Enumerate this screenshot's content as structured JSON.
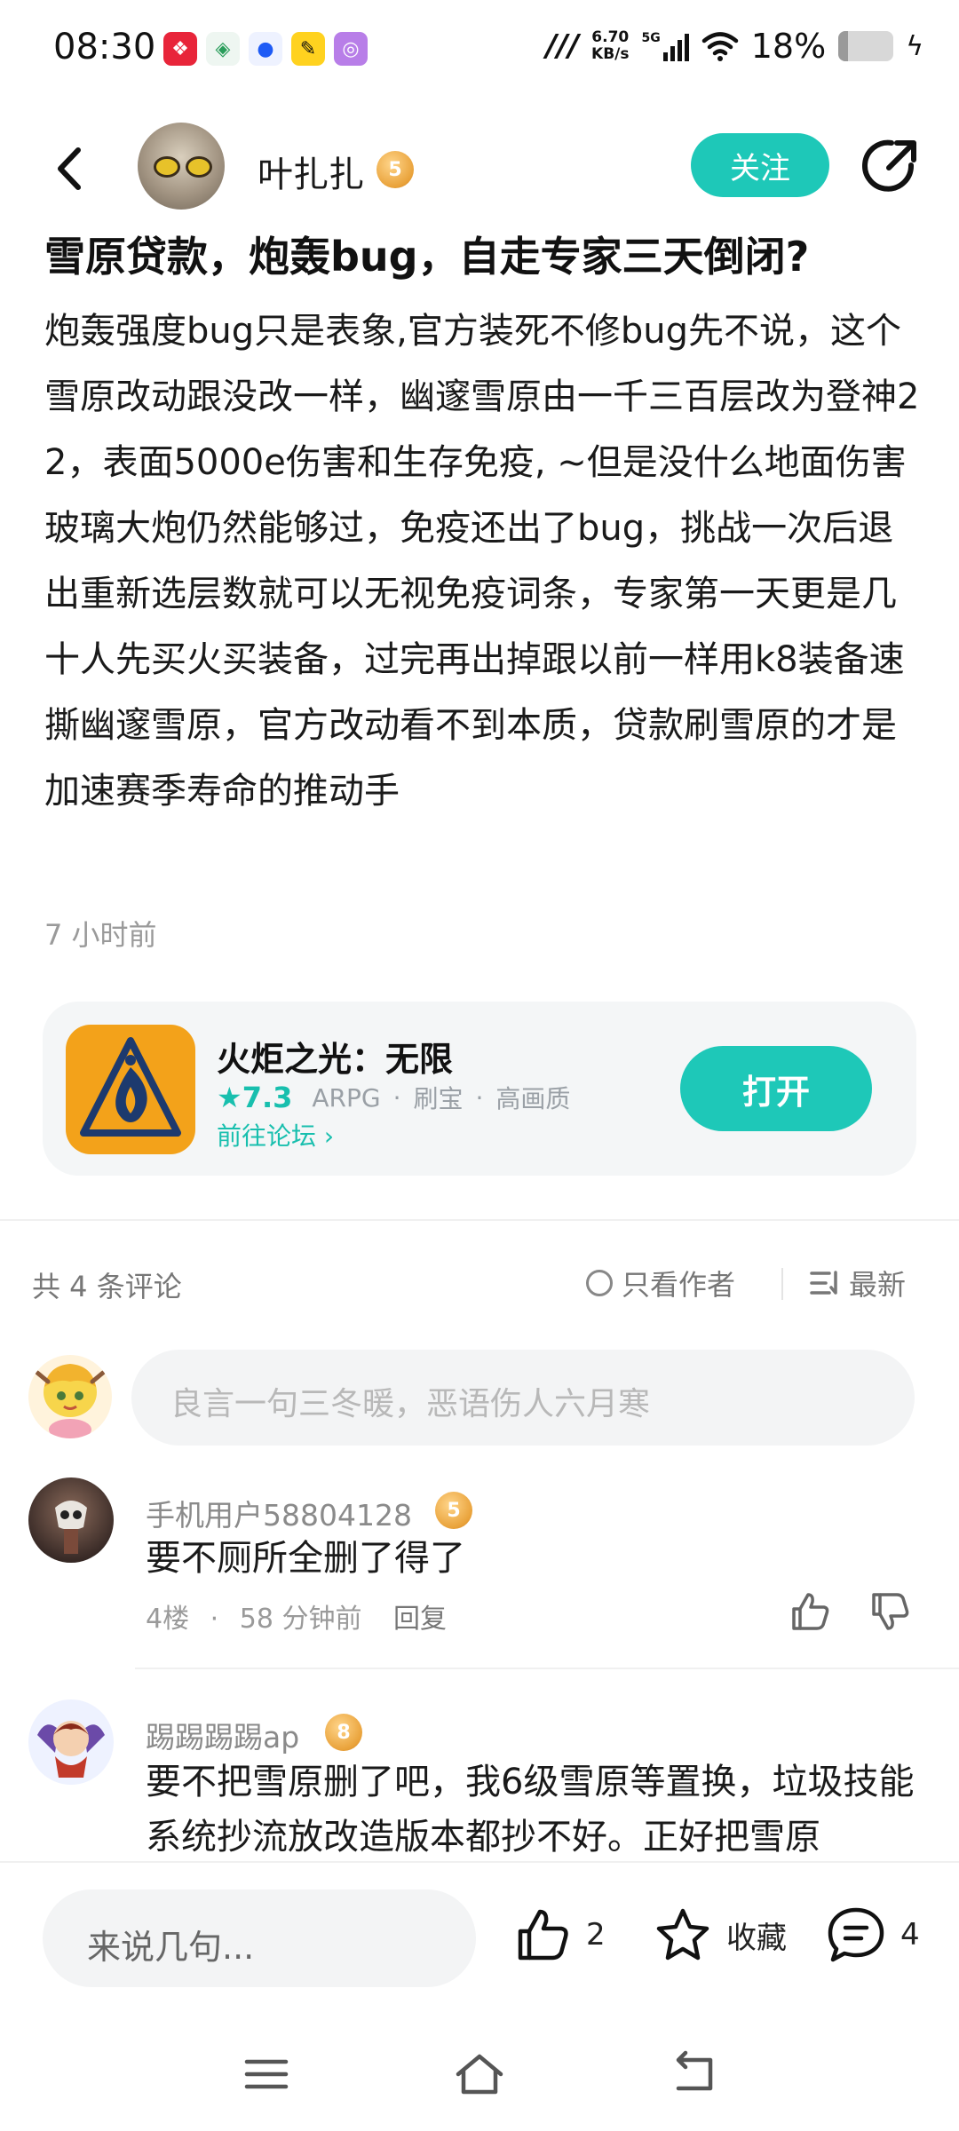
{
  "status_bar": {
    "time": "08:30",
    "net_speed_value": "6.70",
    "net_speed_unit": "KB/s",
    "network": "5G",
    "battery_percent": "18%",
    "battery_level": 0.18
  },
  "header": {
    "author_name": "叶扎扎",
    "author_level": "5",
    "follow_label": "关注"
  },
  "post": {
    "title": "雪原贷款，炮轰bug，自走专家三天倒闭?",
    "body": "炮轰强度bug只是表象,官方装死不修bug先不说，这个雪原改动跟没改一样，幽邃雪原由一千三百层改为登神22，表面5000e伤害和生存免疫, ~但是没什么地面伤害玻璃大炮仍然能够过，免疫还出了bug，挑战一次后退出重新选层数就可以无视免疫词条，专家第一天更是几十人先买火买装备，过完再出掉跟以前一样用k8装备速撕幽邃雪原，官方改动看不到本质，贷款刷雪原的才是加速赛季寿命的推动手",
    "time": "7 小时前"
  },
  "game_card": {
    "name": "火炬之光：无限",
    "score": "7.3",
    "tags": [
      "ARPG",
      "刷宝",
      "高画质"
    ],
    "forum_link": "前往论坛",
    "open_label": "打开"
  },
  "comments_section": {
    "count_label": "共 4 条评论",
    "author_only_label": "只看作者",
    "sort_label": "最新",
    "input_placeholder": "良言一句三冬暖，恶语伤人六月寒"
  },
  "comments": [
    {
      "user": "手机用户58804128",
      "level": "5",
      "text": "要不厕所全删了得了",
      "floor": "4楼",
      "time": "58 分钟前",
      "reply_label": "回复"
    },
    {
      "user": "踢踢踢踢ap",
      "level": "8",
      "text": "要不把雪原删了吧，我6级雪原等置换，垃圾技能系统抄流放改造版本都抄不好。正好把雪原"
    }
  ],
  "bottom_bar": {
    "reply_placeholder": "来说几句...",
    "like_count": "2",
    "favorite_label": "收藏",
    "comment_count": "4"
  },
  "colors": {
    "accent": "#1ec8b8",
    "badge": "#e9a23a",
    "game_icon_bg": "#f3a21a"
  }
}
